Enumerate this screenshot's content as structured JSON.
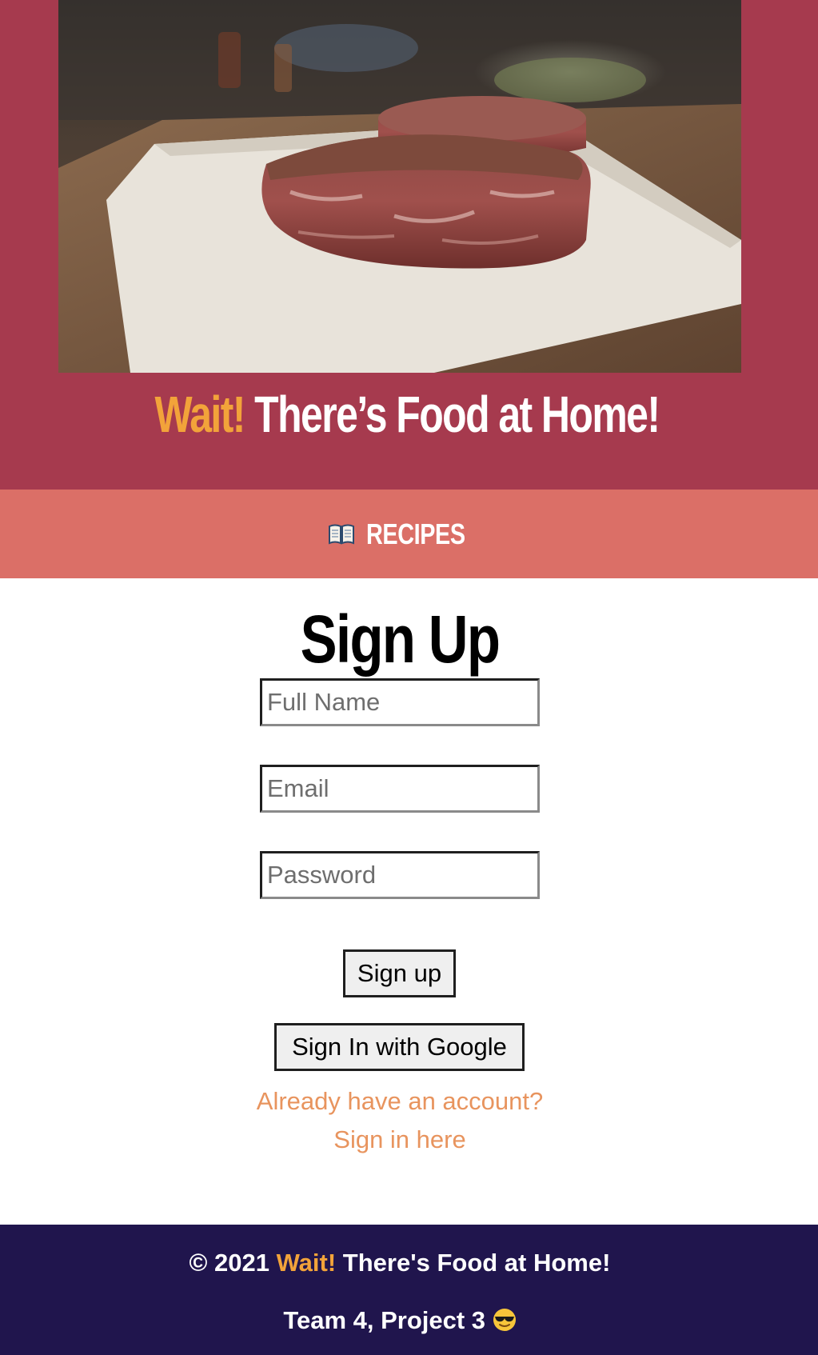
{
  "header": {
    "hero_image": "steak-seasoning-photo",
    "title_accent": "Wait!",
    "title_rest": " There’s Food at Home!",
    "colors": {
      "background": "#a63a4e",
      "accent": "#f2a33a"
    }
  },
  "nav": {
    "items": [
      {
        "icon": "open-book-icon",
        "label": "RECIPES"
      }
    ],
    "background": "#db6f67"
  },
  "signup": {
    "title": "Sign Up",
    "full_name_placeholder": "Full Name",
    "email_placeholder": "Email",
    "password_placeholder": "Password",
    "signup_button": "Sign up",
    "google_button": "Sign In with Google",
    "account_prompt": "Already have an account?",
    "signin_link": "Sign in here",
    "link_color": "#e8945e"
  },
  "footer": {
    "copyright_prefix": "© 2021 ",
    "copyright_accent": "Wait!",
    "copyright_rest": " There's Food at Home!",
    "team_text": "Team 4, Project 3 ",
    "team_icon": "sunglasses-emoji-icon",
    "background": "#20154d"
  }
}
